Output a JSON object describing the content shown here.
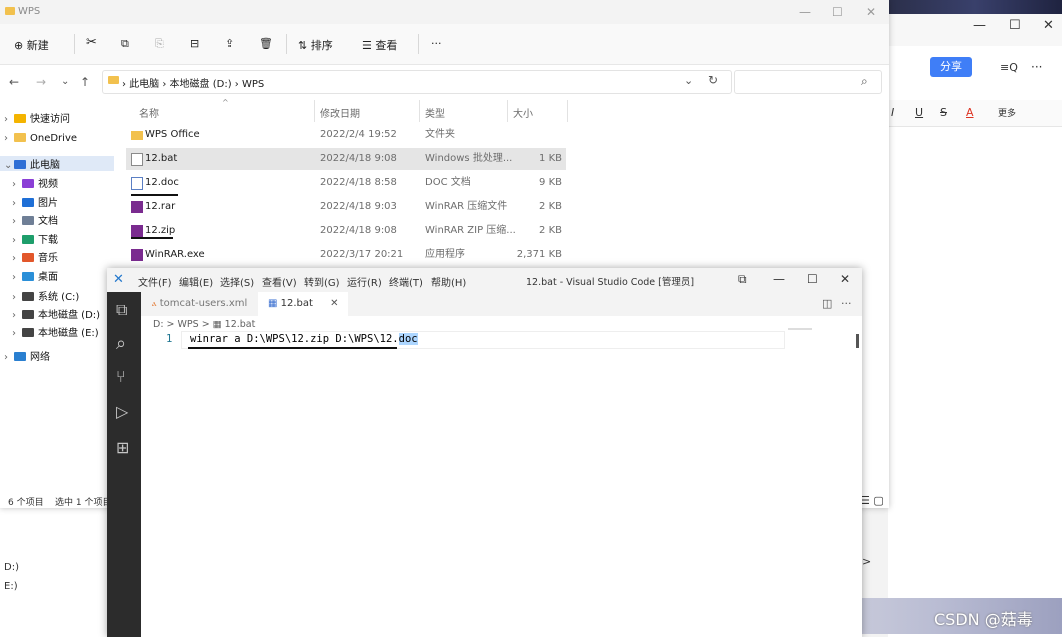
{
  "bg_window": {
    "controls": [
      "—",
      "☐",
      "✕"
    ],
    "share": "分享",
    "toolbar_icons": [
      "≡Q",
      "···"
    ],
    "format_items": [
      "I",
      "U",
      "S",
      "A",
      "更多"
    ],
    "bottom_left": [
      "D:)",
      "E:)"
    ],
    "more_arrow": ">"
  },
  "watermark": "CSDN @菇毒",
  "explorer": {
    "title": "WPS",
    "controls": [
      "—",
      "☐",
      "✕"
    ],
    "toolbar": {
      "new": "⊕ 新建",
      "cut": "✂",
      "copy": "⧉",
      "paste": "⎘",
      "rename": "⊟",
      "share": "⇪",
      "delete": "🗑",
      "sort": "⇅ 排序",
      "view": "☰ 查看",
      "more": "···"
    },
    "nav_buttons": [
      "←",
      "→",
      "⌄",
      "↑"
    ],
    "address": {
      "crumbs": [
        "此电脑",
        "本地磁盘 (D:)",
        "WPS"
      ],
      "dropdown": "⌄",
      "refresh": "↻",
      "search_icon": "⌕"
    },
    "nav_pane": [
      {
        "label": "快速访问",
        "color": "#f4b400",
        "sel": false
      },
      {
        "label": "OneDrive",
        "color": "#f2c14e",
        "sel": false
      },
      {
        "label": "此电脑",
        "color": "#2f6fd6",
        "sel": true
      },
      {
        "label": "视频",
        "color": "#8b3fd6",
        "sel": false
      },
      {
        "label": "图片",
        "color": "#1f6fd6",
        "sel": false
      },
      {
        "label": "文档",
        "color": "#6f7f96",
        "sel": false
      },
      {
        "label": "下载",
        "color": "#1e9e6b",
        "sel": false
      },
      {
        "label": "音乐",
        "color": "#e2572b",
        "sel": false
      },
      {
        "label": "桌面",
        "color": "#2a8fd8",
        "sel": false
      },
      {
        "label": "系统 (C:)",
        "color": "#444444",
        "sel": false
      },
      {
        "label": "本地磁盘 (D:)",
        "color": "#444444",
        "sel": false
      },
      {
        "label": "本地磁盘 (E:)",
        "color": "#444444",
        "sel": false
      },
      {
        "label": "网络",
        "color": "#2a7fd0",
        "sel": false
      }
    ],
    "columns": [
      "名称",
      "修改日期",
      "类型",
      "大小"
    ],
    "files": [
      {
        "name": "WPS Office",
        "date": "2022/2/4 19:52",
        "type": "文件夹",
        "size": "",
        "icon_color": "#f2c14e"
      },
      {
        "name": "12.bat",
        "date": "2022/4/18 9:08",
        "type": "Windows 批处理...",
        "size": "1 KB",
        "icon_color": "#8a8a8a"
      },
      {
        "name": "12.doc",
        "date": "2022/4/18 8:58",
        "type": "DOC 文档",
        "size": "9 KB",
        "icon_color": "#5b7fc4"
      },
      {
        "name": "12.rar",
        "date": "2022/4/18 9:03",
        "type": "WinRAR 压缩文件",
        "size": "2 KB",
        "icon_color": "#7a2b8f"
      },
      {
        "name": "12.zip",
        "date": "2022/4/18 9:08",
        "type": "WinRAR ZIP 压缩...",
        "size": "2 KB",
        "icon_color": "#7a2b8f"
      },
      {
        "name": "WinRAR.exe",
        "date": "2022/3/17 20:21",
        "type": "应用程序",
        "size": "2,371 KB",
        "icon_color": "#7a2b8f"
      }
    ],
    "status": "6 个项目    选中 1 个项目",
    "view_icons": "☰ ▢"
  },
  "vscode": {
    "logo": "✕",
    "menu": [
      "文件(F)",
      "编辑(E)",
      "选择(S)",
      "查看(V)",
      "转到(G)",
      "运行(R)",
      "终端(T)",
      "帮助(H)"
    ],
    "title": "12.bat - Visual Studio Code [管理员]",
    "controls": [
      "⧉",
      "—",
      "☐",
      "✕"
    ],
    "activity": [
      "⧉",
      "⌕",
      "⑂",
      "▷",
      "⊞"
    ],
    "tabs": [
      {
        "label": "tomcat-users.xml",
        "icon": "ⲁ"
      },
      {
        "label": "12.bat",
        "icon": "▦",
        "close": "✕"
      }
    ],
    "tab_actions": [
      "◫",
      "···"
    ],
    "breadcrumb": "D: > WPS > ▦ 12.bat",
    "line_number": "1",
    "code_prefix": "winrar a D:\\WPS\\12.zip D:\\WPS\\12.",
    "code_selected": "doc"
  }
}
